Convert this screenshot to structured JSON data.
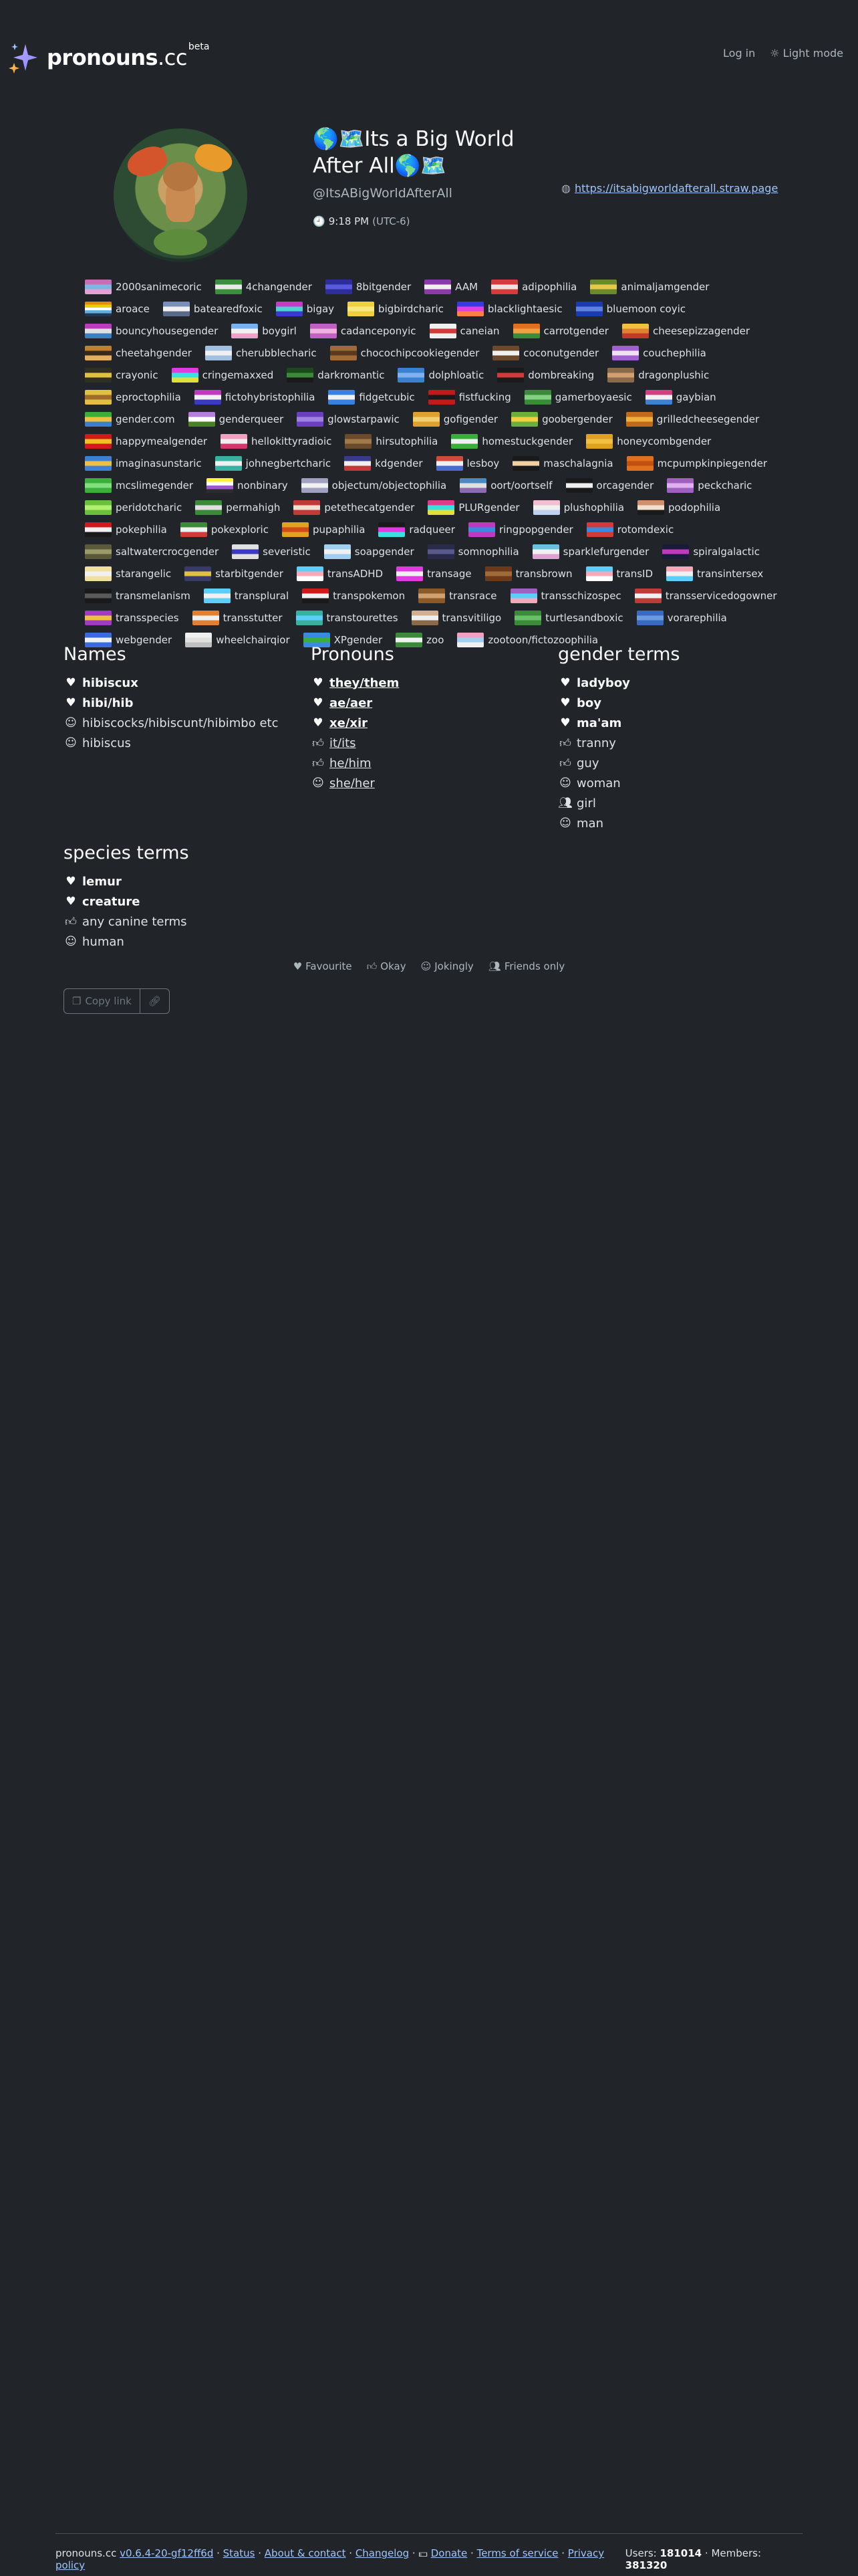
{
  "header": {
    "logo_name": "pronouns",
    "logo_tld": ".cc",
    "logo_badge": "beta",
    "login": "Log in",
    "theme": "Light mode"
  },
  "profile": {
    "display_name_prefix": "🌎🗺️",
    "display_name": "Its a Big World After All",
    "display_name_suffix": "🌎🗺️",
    "username": "@ItsABigWorldAfterAll",
    "time": "9:18 PM",
    "timezone": "(UTC-6)",
    "link": "https://itsabigworldafterall.straw.page"
  },
  "flags": [
    {
      "name": "2000sanimecoric",
      "colors": [
        "#c66fb8",
        "#7bb7e0",
        "#e5a0d8"
      ]
    },
    {
      "name": "4changender",
      "colors": [
        "#3a8f3a",
        "#e8e8e8",
        "#3a8f3a"
      ]
    },
    {
      "name": "8bitgender",
      "colors": [
        "#2d2d9c",
        "#5a5ae0",
        "#2d2d9c"
      ]
    },
    {
      "name": "AAM",
      "colors": [
        "#8b3aa8",
        "#f0f0f0",
        "#8b3aa8"
      ]
    },
    {
      "name": "adipophilia",
      "colors": [
        "#d63a3a",
        "#f0e0e0",
        "#d63a3a"
      ]
    },
    {
      "name": "animaljamgender",
      "colors": [
        "#6b8a2a",
        "#e8c84a",
        "#6b8a2a"
      ]
    },
    {
      "name": "aroace",
      "colors": [
        "#e28d00",
        "#eccd00",
        "#ffffff",
        "#62aedc",
        "#203856"
      ]
    },
    {
      "name": "batearedfoxic",
      "colors": [
        "#7a8fb8",
        "#f0f0f0",
        "#5a6a8a"
      ]
    },
    {
      "name": "bigay",
      "colors": [
        "#c63ac6",
        "#50d0d0",
        "#3a3ad0"
      ]
    },
    {
      "name": "bigbirdcharic",
      "colors": [
        "#f0d040",
        "#f8e880",
        "#f0d040"
      ]
    },
    {
      "name": "blacklightaesic",
      "colors": [
        "#3a3ae0",
        "#e040e0",
        "#ff8040"
      ]
    },
    {
      "name": "bluemoon coyic",
      "colors": [
        "#1a3ab0",
        "#6080e0",
        "#1a3ab0"
      ]
    },
    {
      "name": "bouncyhousegender",
      "colors": [
        "#c03ac0",
        "#e0e0e0",
        "#3a80c0"
      ]
    },
    {
      "name": "boygirl",
      "colors": [
        "#7ab0f0",
        "#f0f0f0",
        "#f0a0c8"
      ]
    },
    {
      "name": "cadanceponyic",
      "colors": [
        "#c060c0",
        "#f0b0e0",
        "#c060c0"
      ]
    },
    {
      "name": "caneian",
      "colors": [
        "#f0f0f0",
        "#d03a3a",
        "#f0f0f0"
      ]
    },
    {
      "name": "carrotgender",
      "colors": [
        "#e07020",
        "#f0a040",
        "#3a8a3a"
      ]
    },
    {
      "name": "cheesepizzagender",
      "colors": [
        "#f0c040",
        "#e08030",
        "#c03a2a"
      ]
    },
    {
      "name": "cheetahgender",
      "colors": [
        "#c08030",
        "#3a2a1a",
        "#e0b060"
      ]
    },
    {
      "name": "cherubblecharic",
      "colors": [
        "#a0c0e0",
        "#f0f0f0",
        "#a0c0e0"
      ]
    },
    {
      "name": "chocochipcookiegender",
      "colors": [
        "#a06a3a",
        "#5a3a1a",
        "#a06a3a"
      ]
    },
    {
      "name": "coconutgender",
      "colors": [
        "#6a4a2a",
        "#f0f0f0",
        "#6a4a2a"
      ]
    },
    {
      "name": "couchephilia",
      "colors": [
        "#a060d0",
        "#f0e0f0",
        "#a060d0"
      ]
    },
    {
      "name": "crayonic",
      "colors": [
        "#303020",
        "#e0c040",
        "#303020"
      ]
    },
    {
      "name": "cringemaxxed",
      "colors": [
        "#e03ae0",
        "#3ae0e0",
        "#e0e03a"
      ]
    },
    {
      "name": "darkromantic",
      "colors": [
        "#1a4a1a",
        "#3a8a3a",
        "#1a1a1a"
      ]
    },
    {
      "name": "dolphloatic",
      "colors": [
        "#3a80d0",
        "#80b0f0",
        "#3a80d0"
      ]
    },
    {
      "name": "dombreaking",
      "colors": [
        "#1a1a1a",
        "#d03a3a",
        "#1a1a1a"
      ]
    },
    {
      "name": "dragonplushic",
      "colors": [
        "#8a6a4a",
        "#d0a070",
        "#8a6a4a"
      ]
    },
    {
      "name": "eproctophilia",
      "colors": [
        "#e0c040",
        "#a06a2a",
        "#e0c040"
      ]
    },
    {
      "name": "fictohybristophilia",
      "colors": [
        "#c03ac0",
        "#f0f0f0",
        "#3a3ac0"
      ]
    },
    {
      "name": "fidgetcubic",
      "colors": [
        "#3a80e0",
        "#f0f0f0",
        "#3a80e0"
      ]
    },
    {
      "name": "fistfucking",
      "colors": [
        "#c01a1a",
        "#1a1a1a",
        "#c01a1a"
      ]
    },
    {
      "name": "gamerboyaesic",
      "colors": [
        "#3a8a3a",
        "#80d080",
        "#3a8a3a"
      ]
    },
    {
      "name": "gaybian",
      "colors": [
        "#d04080",
        "#f0f0f0",
        "#4080d0"
      ]
    },
    {
      "name": "gender.com",
      "colors": [
        "#3ab03a",
        "#f0c040",
        "#3a80d0"
      ]
    },
    {
      "name": "genderqueer",
      "colors": [
        "#b57edc",
        "#ffffff",
        "#4a8123"
      ]
    },
    {
      "name": "glowstarpawic",
      "colors": [
        "#6a40c0",
        "#a080e0",
        "#6a40c0"
      ]
    },
    {
      "name": "gofigender",
      "colors": [
        "#e0a030",
        "#f0d070",
        "#e0a030"
      ]
    },
    {
      "name": "goobergender",
      "colors": [
        "#6ab03a",
        "#f0d040",
        "#6ab03a"
      ]
    },
    {
      "name": "grilledcheesegender",
      "colors": [
        "#c06a1a",
        "#f0b040",
        "#c06a1a"
      ]
    },
    {
      "name": "happymealgender",
      "colors": [
        "#d01a1a",
        "#f0c020",
        "#d01a1a"
      ]
    },
    {
      "name": "hellokittyradioic",
      "colors": [
        "#f0a0c0",
        "#f0f0f0",
        "#d03a6a"
      ]
    },
    {
      "name": "hirsutophilia",
      "colors": [
        "#6a4a2a",
        "#a07a4a",
        "#6a4a2a"
      ]
    },
    {
      "name": "homestuckgender",
      "colors": [
        "#3ab03a",
        "#f0f0f0",
        "#3ab03a"
      ]
    },
    {
      "name": "honeycombgender",
      "colors": [
        "#e0a020",
        "#f0c040",
        "#e0a020"
      ]
    },
    {
      "name": "imaginasunstaric",
      "colors": [
        "#4080d0",
        "#f0c040",
        "#4080d0"
      ]
    },
    {
      "name": "johnegbertcharic",
      "colors": [
        "#3ab0a0",
        "#f0f0f0",
        "#3ab0a0"
      ]
    },
    {
      "name": "kdgender",
      "colors": [
        "#3a3a8a",
        "#f0f0f0",
        "#c03a3a"
      ]
    },
    {
      "name": "lesboy",
      "colors": [
        "#d04a3a",
        "#f0f0f0",
        "#4a6ad0"
      ]
    },
    {
      "name": "maschalagnia",
      "colors": [
        "#1a1a1a",
        "#f0d0a0",
        "#1a1a1a"
      ]
    },
    {
      "name": "mcpumpkinpiegender",
      "colors": [
        "#e07020",
        "#c05010",
        "#e07020"
      ]
    },
    {
      "name": "mcslimegender",
      "colors": [
        "#3ab03a",
        "#80e080",
        "#3ab03a"
      ]
    },
    {
      "name": "nonbinary",
      "colors": [
        "#fcf434",
        "#ffffff",
        "#9c59d1",
        "#2c2c2c"
      ]
    },
    {
      "name": "objectum/objectophilia",
      "colors": [
        "#a0a0c0",
        "#f0f0f0",
        "#a0a0c0"
      ]
    },
    {
      "name": "oort/oortself",
      "colors": [
        "#4a8ac0",
        "#e0e0e0",
        "#8a6ab0"
      ]
    },
    {
      "name": "orcagender",
      "colors": [
        "#1a1a1a",
        "#f0f0f0",
        "#1a1a1a"
      ]
    },
    {
      "name": "peckcharic",
      "colors": [
        "#a060c0",
        "#e0b0f0",
        "#a060c0"
      ]
    },
    {
      "name": "peridotcharic",
      "colors": [
        "#6ac03a",
        "#b0f070",
        "#6ac03a"
      ]
    },
    {
      "name": "permahigh",
      "colors": [
        "#3a8a3a",
        "#e0e0e0",
        "#3a8a3a"
      ]
    },
    {
      "name": "petethecatgender",
      "colors": [
        "#c03a3a",
        "#f0e0d0",
        "#c03a3a"
      ]
    },
    {
      "name": "PLURgender",
      "colors": [
        "#e03a8a",
        "#3ae0e0",
        "#e0e03a"
      ]
    },
    {
      "name": "plushophilia",
      "colors": [
        "#f0c0d0",
        "#f0f0f0",
        "#c0d0f0"
      ]
    },
    {
      "name": "podophilia",
      "colors": [
        "#d09070",
        "#f0e0d0",
        "#1a1a1a"
      ]
    },
    {
      "name": "pokephilia",
      "colors": [
        "#d01a1a",
        "#f0f0f0",
        "#1a1a1a"
      ]
    },
    {
      "name": "pokexploric",
      "colors": [
        "#3a8a3a",
        "#f0f0f0",
        "#d03a3a"
      ]
    },
    {
      "name": "pupaphilia",
      "colors": [
        "#e0a020",
        "#d04a1a",
        "#e0a020"
      ]
    },
    {
      "name": "radqueer",
      "colors": [
        "#1a1a1a",
        "#e03ae0",
        "#3ae0e0"
      ]
    },
    {
      "name": "ringpopgender",
      "colors": [
        "#c03ac0",
        "#3a8ae0",
        "#c03ac0"
      ]
    },
    {
      "name": "rotomdexic",
      "colors": [
        "#d03a3a",
        "#3a8ae0",
        "#d03a3a"
      ]
    },
    {
      "name": "saltwatercrocgender",
      "colors": [
        "#5a5a3a",
        "#9a9a6a",
        "#5a5a3a"
      ]
    },
    {
      "name": "severistic",
      "colors": [
        "#e0e0e0",
        "#3a3ac0",
        "#e0e0e0"
      ]
    },
    {
      "name": "soapgender",
      "colors": [
        "#a0d0f0",
        "#f0f0f0",
        "#a0d0f0"
      ]
    },
    {
      "name": "somnophilia",
      "colors": [
        "#2a2a4a",
        "#5a5a8a",
        "#2a2a4a"
      ]
    },
    {
      "name": "sparklefurgender",
      "colors": [
        "#6ac0e0",
        "#f0f0f0",
        "#e0a0d0"
      ]
    },
    {
      "name": "spiralgalactic",
      "colors": [
        "#1a1a3a",
        "#c03ac0",
        "#1a1a3a"
      ]
    },
    {
      "name": "starangelic",
      "colors": [
        "#f0e0a0",
        "#f0f0f0",
        "#f0e0a0"
      ]
    },
    {
      "name": "starbitgender",
      "colors": [
        "#3a3a6a",
        "#e0c040",
        "#3a3a6a"
      ]
    },
    {
      "name": "transADHD",
      "colors": [
        "#5bcefa",
        "#f5a9b8",
        "#ffffff"
      ]
    },
    {
      "name": "transage",
      "colors": [
        "#e03ae0",
        "#f0f0f0",
        "#e03ae0"
      ]
    },
    {
      "name": "transbrown",
      "colors": [
        "#6a3a1a",
        "#a06a3a",
        "#6a3a1a"
      ]
    },
    {
      "name": "transID",
      "colors": [
        "#5bcefa",
        "#f5a9b8",
        "#ffffff"
      ]
    },
    {
      "name": "transintersex",
      "colors": [
        "#f5a9b8",
        "#f0f0f0",
        "#5bcefa"
      ]
    },
    {
      "name": "transmelanism",
      "colors": [
        "#1a1a1a",
        "#5a5a5a",
        "#1a1a1a"
      ]
    },
    {
      "name": "transplural",
      "colors": [
        "#5bcefa",
        "#f0f0f0",
        "#5bcefa"
      ]
    },
    {
      "name": "transpokemon",
      "colors": [
        "#d01a1a",
        "#f0f0f0",
        "#1a1a1a"
      ]
    },
    {
      "name": "transrace",
      "colors": [
        "#8a5a2a",
        "#d0a070",
        "#8a5a2a"
      ]
    },
    {
      "name": "transschizospec",
      "colors": [
        "#a060c0",
        "#5bcefa",
        "#f5a9b8"
      ]
    },
    {
      "name": "transservicedogowner",
      "colors": [
        "#c03a3a",
        "#f0f0f0",
        "#c03a3a"
      ]
    },
    {
      "name": "transspecies",
      "colors": [
        "#a03ac0",
        "#f0c040",
        "#a03ac0"
      ]
    },
    {
      "name": "transstutter",
      "colors": [
        "#e08030",
        "#f0f0f0",
        "#e08030"
      ]
    },
    {
      "name": "transtourettes",
      "colors": [
        "#3ab0a0",
        "#5bcefa",
        "#3ab0a0"
      ]
    },
    {
      "name": "transvitiligo",
      "colors": [
        "#d0b090",
        "#f0f0f0",
        "#8a6a4a"
      ]
    },
    {
      "name": "turtlesandboxic",
      "colors": [
        "#3a8a3a",
        "#6ac06a",
        "#3a8a3a"
      ]
    },
    {
      "name": "vorarephilia",
      "colors": [
        "#3a6ac0",
        "#6a9ae0",
        "#3a6ac0"
      ]
    },
    {
      "name": "webgender",
      "colors": [
        "#3a6ae0",
        "#f0f0f0",
        "#3a6ae0"
      ]
    },
    {
      "name": "wheelchairqior",
      "colors": [
        "#f0f0f0",
        "#e0e0e0",
        "#c0c0c0"
      ]
    },
    {
      "name": "XPgender",
      "colors": [
        "#3a8ae0",
        "#3ab03a",
        "#3a8ae0"
      ]
    },
    {
      "name": "zoo",
      "colors": [
        "#3a8a3a",
        "#f0f0f0",
        "#3a8a3a"
      ]
    },
    {
      "name": "zootoon/fictozoophilia",
      "colors": [
        "#f0a0c0",
        "#a0d0f0",
        "#f0f0f0"
      ]
    }
  ],
  "names": {
    "title": "Names",
    "items": [
      {
        "text": "hibiscux",
        "kind": "fav"
      },
      {
        "text": "hibi/hib",
        "kind": "fav"
      },
      {
        "text": "hibiscocks/hibiscunt/hibimbo etc",
        "kind": "joke"
      },
      {
        "text": "hibiscus",
        "kind": "joke"
      }
    ]
  },
  "pronouns": {
    "title": "Pronouns",
    "items": [
      {
        "text": "they/them",
        "kind": "fav"
      },
      {
        "text": "ae/aer",
        "kind": "fav"
      },
      {
        "text": "xe/xir",
        "kind": "fav"
      },
      {
        "text": "it/its",
        "kind": "okay"
      },
      {
        "text": "he/him",
        "kind": "okay"
      },
      {
        "text": "she/her",
        "kind": "joke"
      }
    ]
  },
  "gender_terms": {
    "title": "gender terms",
    "items": [
      {
        "text": "ladyboy",
        "kind": "fav"
      },
      {
        "text": "boy",
        "kind": "fav"
      },
      {
        "text": "ma'am",
        "kind": "fav"
      },
      {
        "text": "tranny",
        "kind": "okay"
      },
      {
        "text": "guy",
        "kind": "okay"
      },
      {
        "text": "woman",
        "kind": "joke"
      },
      {
        "text": "girl",
        "kind": "friends"
      },
      {
        "text": "man",
        "kind": "joke"
      }
    ]
  },
  "species_terms": {
    "title": "species terms",
    "items": [
      {
        "text": "lemur",
        "kind": "fav"
      },
      {
        "text": "creature",
        "kind": "fav"
      },
      {
        "text": "any canine terms",
        "kind": "okay"
      },
      {
        "text": "human",
        "kind": "joke"
      }
    ]
  },
  "legend": {
    "favourite": "Favourite",
    "okay": "Okay",
    "jokingly": "Jokingly",
    "friends": "Friends only"
  },
  "actions": {
    "copy": "Copy link"
  },
  "footer": {
    "site": "pronouns.cc",
    "version": "v0.6.4-20-gf12ff6d",
    "status": "Status",
    "about": "About & contact",
    "changelog": "Changelog",
    "donate": "Donate",
    "tos": "Terms of service",
    "privacy": "Privacy policy",
    "users_label": "Users:",
    "users": "181014",
    "members_label": "Members:",
    "members": "381320"
  }
}
